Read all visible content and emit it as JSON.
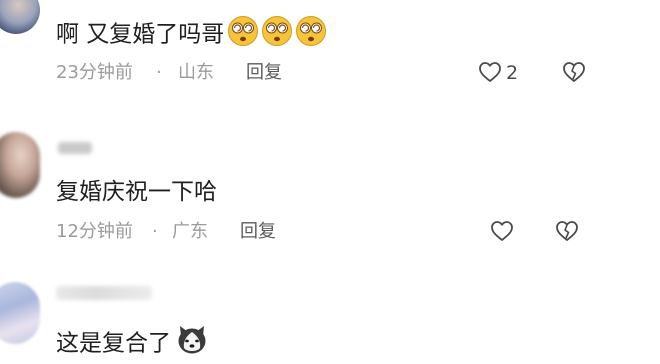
{
  "comments": [
    {
      "text": "啊 又复婚了吗哥",
      "emoji": [
        "dizzy-face",
        "dizzy-face",
        "dizzy-face"
      ],
      "time": "23分钟前",
      "separator": "·",
      "location": "山东",
      "reply": "回复",
      "likes": "2"
    },
    {
      "text": "复婚庆祝一下哈",
      "time": "12分钟前",
      "separator": "·",
      "location": "广东",
      "reply": "回复"
    },
    {
      "text": "这是复合了",
      "emoji": [
        "husky-dog-face"
      ]
    }
  ],
  "colors": {
    "emoji_yellow": "#f5c43a",
    "meta_gray": "#9b9b9b",
    "text": "#1f1f1f"
  }
}
